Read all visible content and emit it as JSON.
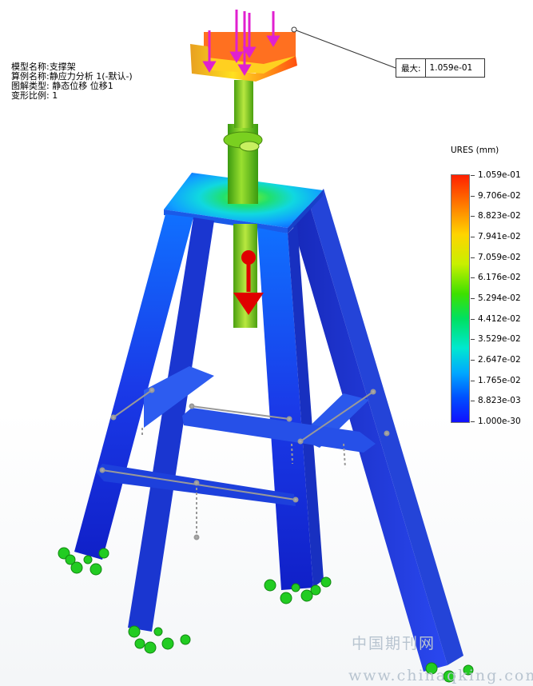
{
  "study_info": {
    "model_name": "模型名称:支撑架",
    "study_name": "算例名称:静应力分析 1(-默认-)",
    "plot_type": "图解类型: 静态位移 位移1",
    "deformation_scale": "变形比例: 1"
  },
  "probe": {
    "label": "最大:",
    "value": "1.059e-01"
  },
  "legend": {
    "title": "URES (mm)",
    "values": [
      "1.059e-01",
      "9.706e-02",
      "8.823e-02",
      "7.941e-02",
      "7.059e-02",
      "6.176e-02",
      "5.294e-02",
      "4.412e-02",
      "3.529e-02",
      "2.647e-02",
      "1.765e-02",
      "8.823e-03",
      "1.000e-30"
    ],
    "max_color": "#ff2000",
    "min_color": "#1010ff"
  },
  "watermark": {
    "line1": "中国期刊网",
    "line2": "www.chinaqking.com"
  },
  "colors": {
    "frame_blue": "#1a2fe0",
    "load_arrow": "#e020d0",
    "fixture": "#22cc22",
    "force": "#e00000"
  }
}
